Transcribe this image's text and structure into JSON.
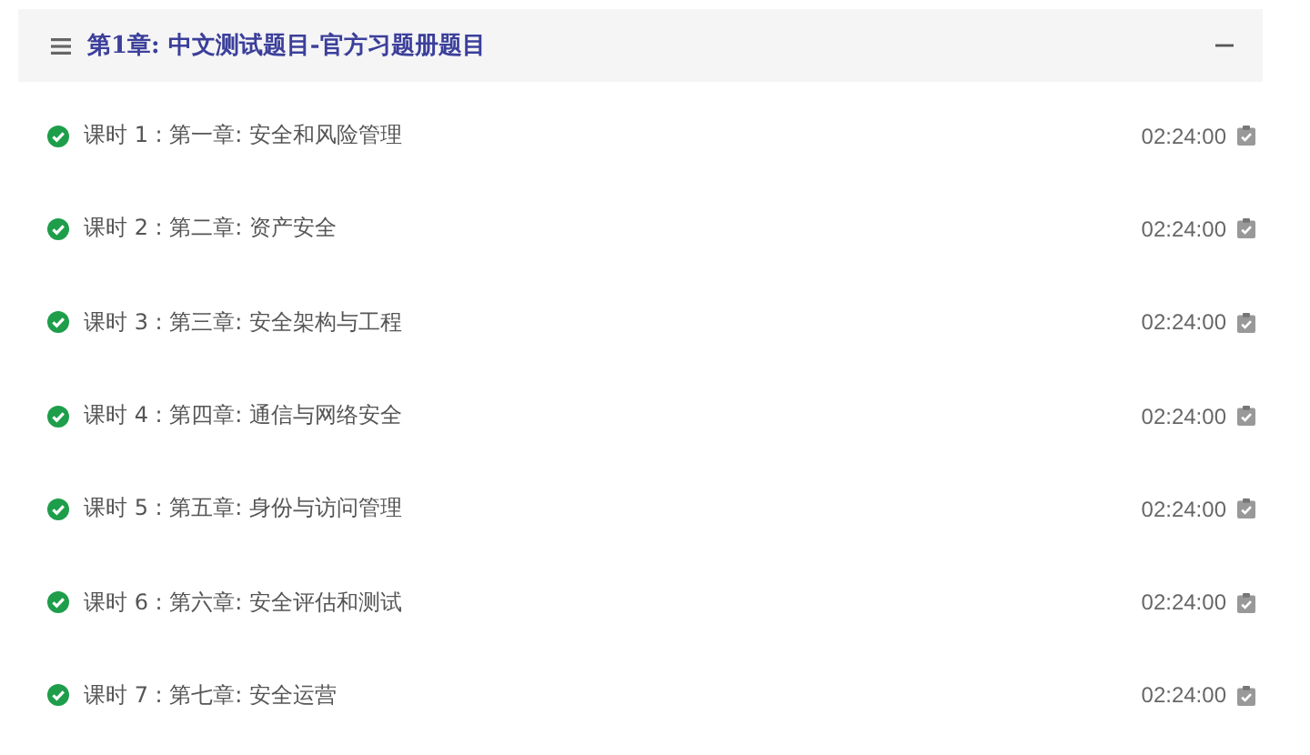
{
  "chapter": {
    "title": "第1章: 中文测试题目-官方习题册题目",
    "expanded": true
  },
  "lessons": [
    {
      "label": "课时 1 : 第一章:  安全和风险管理",
      "duration": "02:24:00",
      "completed": true
    },
    {
      "label": "课时 2 : 第二章:  资产安全",
      "duration": "02:24:00",
      "completed": true
    },
    {
      "label": "课时 3 : 第三章:  安全架构与工程",
      "duration": "02:24:00",
      "completed": true
    },
    {
      "label": "课时 4 : 第四章:  通信与网络安全",
      "duration": "02:24:00",
      "completed": true
    },
    {
      "label": "课时 5 : 第五章:  身份与访问管理",
      "duration": "02:24:00",
      "completed": true
    },
    {
      "label": "课时 6 : 第六章:  安全评估和测试",
      "duration": "02:24:00",
      "completed": true
    },
    {
      "label": "课时 7 : 第七章:  安全运营",
      "duration": "02:24:00",
      "completed": true
    }
  ]
}
